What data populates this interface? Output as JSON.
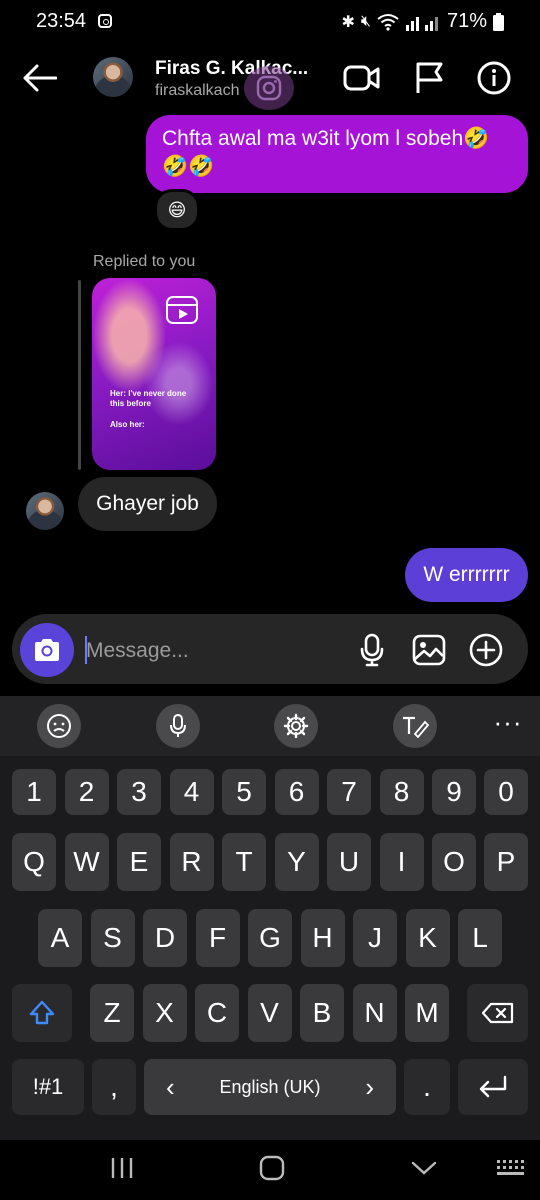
{
  "status": {
    "time": "23:54",
    "battery": "71%"
  },
  "header": {
    "contact_name": "Firas G. Kalkac...",
    "contact_handle": "firaskalkach"
  },
  "messages": {
    "sent_1": "Chfta awal ma w3it lyom l sobeh🤣🤣🤣",
    "sent_1_reaction": "😄",
    "replied_label": "Replied to you",
    "reel_caption_1": "Her: I've never done this before",
    "reel_caption_2": "Also her:",
    "received_1": "Ghayer job",
    "sent_2": "W errrrrrr"
  },
  "composer": {
    "placeholder": "Message..."
  },
  "keyboard": {
    "row_numbers": [
      "1",
      "2",
      "3",
      "4",
      "5",
      "6",
      "7",
      "8",
      "9",
      "0"
    ],
    "row_1": [
      "Q",
      "W",
      "E",
      "R",
      "T",
      "Y",
      "U",
      "I",
      "O",
      "P"
    ],
    "row_2": [
      "A",
      "S",
      "D",
      "F",
      "G",
      "H",
      "J",
      "K",
      "L"
    ],
    "row_3": [
      "Z",
      "X",
      "C",
      "V",
      "B",
      "N",
      "M"
    ],
    "symbols_key": "!#1",
    "comma_key": ",",
    "language": "English (UK)",
    "lang_prev": "‹",
    "lang_next": "›",
    "period_key": "."
  },
  "colors": {
    "sent_bubble_1": "#a514d6",
    "sent_bubble_2": "#5b3fd6",
    "received_bubble": "#262626",
    "camera_button": "#5a43d9"
  }
}
